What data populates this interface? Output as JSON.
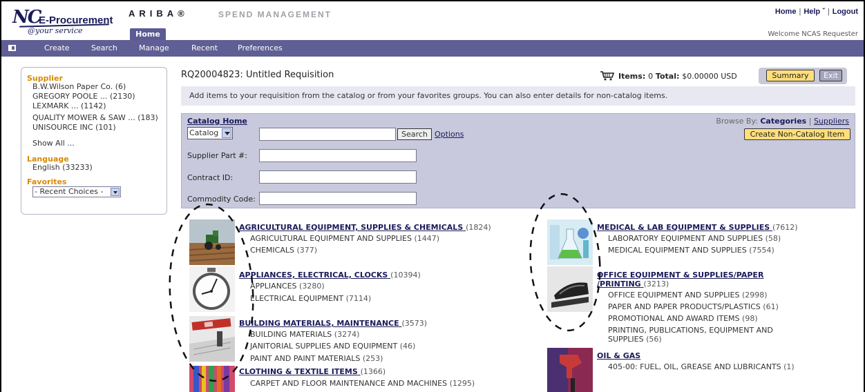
{
  "header": {
    "logo_nc": "NC",
    "logo_product": "E-Procurement",
    "logo_tagline": "@your service",
    "ariba": "ARIBA®",
    "spend_management": "SPEND MANAGEMENT",
    "home_tab": "Home",
    "links": {
      "home": "Home",
      "help": "Help ˇ",
      "logout": "Logout"
    },
    "welcome": "Welcome NCAS Requester"
  },
  "nav": {
    "create": "Create",
    "search": "Search",
    "manage": "Manage",
    "recent": "Recent",
    "preferences": "Preferences"
  },
  "sidebar": {
    "supplier_heading": "Supplier",
    "suppliers": [
      {
        "name": "B.W.Wilson Paper Co.",
        "count": "(6)"
      },
      {
        "name": "GREGORY POOLE ...",
        "count": "(2130)"
      },
      {
        "name": "LEXMARK ...",
        "count": "(1142)"
      },
      {
        "name": "QUALITY MOWER & SAW ...",
        "count": "(183)"
      },
      {
        "name": "UNISOURCE INC",
        "count": "(101)"
      }
    ],
    "show_all": "Show All ...",
    "language_heading": "Language",
    "language": {
      "name": "English",
      "count": "(33233)"
    },
    "favorites_heading": "Favorites",
    "favorites_select": "- Recent Choices -"
  },
  "requisition": {
    "title": "RQ20004823: Untitled Requisition",
    "items_label": "Items:",
    "items_value": "0",
    "total_label": "Total:",
    "total_value": "$0.00000 USD",
    "summary_button": "Summary",
    "exit_button": "Exit",
    "instructions": "Add items to your requisition from the catalog or from your favorites groups. You can also enter details for non-catalog items."
  },
  "catalog": {
    "home_link": "Catalog Home",
    "browse_by": "Browse By:",
    "browse_categories": "Categories",
    "browse_separator": "|",
    "browse_suppliers": "Suppliers",
    "create_noncatalog": "Create Non-Catalog Item",
    "catalog_select": "Catalog",
    "search_value": "",
    "search_button": "Search",
    "options_link": "Options",
    "supplier_part_label": "Supplier Part #:",
    "contract_id_label": "Contract ID:",
    "commodity_code_label": "Commodity Code:"
  },
  "categories": {
    "agri": {
      "title": "AGRICULTURAL EQUIPMENT, SUPPLIES & CHEMICALS",
      "count": "(1824)",
      "subs": [
        {
          "name": "AGRICULTURAL EQUIPMENT AND SUPPLIES",
          "count": "(1447)"
        },
        {
          "name": "CHEMICALS",
          "count": "(377)"
        }
      ]
    },
    "appl": {
      "title": "APPLIANCES, ELECTRICAL, CLOCKS",
      "count": "(10394)",
      "subs": [
        {
          "name": "APPLIANCES",
          "count": "(3280)"
        },
        {
          "name": "ELECTRICAL EQUIPMENT",
          "count": "(7114)"
        }
      ]
    },
    "bldg": {
      "title": "BUILDING MATERIALS, MAINTENANCE",
      "count": "(3573)",
      "subs": [
        {
          "name": "BUILDING MATERIALS",
          "count": "(3274)"
        },
        {
          "name": "JANITORIAL SUPPLIES AND EQUIPMENT",
          "count": "(46)"
        },
        {
          "name": "PAINT AND PAINT MATERIALS",
          "count": "(253)"
        }
      ]
    },
    "cloth": {
      "title": "CLOTHING & TEXTILE ITEMS",
      "count": "(1366)",
      "subs": [
        {
          "name": "CARPET AND FLOOR MAINTENANCE AND MACHINES",
          "count": "(1295)"
        }
      ]
    },
    "med": {
      "title": "MEDICAL & LAB EQUIPMENT & SUPPLIES",
      "count": "(7612)",
      "subs": [
        {
          "name": "LABORATORY EQUIPMENT AND SUPPLIES",
          "count": "(58)"
        },
        {
          "name": "MEDICAL EQUIPMENT AND SUPPLIES",
          "count": "(7554)"
        }
      ]
    },
    "office": {
      "title_line1": "OFFICE EQUIPMENT & SUPPLIES/PAPER",
      "title_line2": "/PRINTING",
      "count": "(3213)",
      "subs": [
        {
          "name": "OFFICE EQUIPMENT AND SUPPLIES",
          "count": "(2998)"
        },
        {
          "name": "PAPER AND PAPER PRODUCTS/PLASTICS",
          "count": "(61)"
        },
        {
          "name": "PROMOTIONAL AND AWARD ITEMS",
          "count": "(98)"
        },
        {
          "name": "PRINTING, PUBLICATIONS, EQUIPMENT AND",
          "name2": "SUPPLIES",
          "count": "(56)"
        }
      ]
    },
    "oil": {
      "title": "OIL & GAS",
      "subs": [
        {
          "name": "405-00: FUEL, OIL, GREASE AND LUBRICANTS",
          "count": "(1)"
        }
      ]
    }
  },
  "colors": {
    "nav_bg": "#5f5f95",
    "panel_bg": "#c9c9dd",
    "link": "#1a1a5a",
    "heading_orange": "#d88a00",
    "button_yellow": "#ffdf7a"
  }
}
